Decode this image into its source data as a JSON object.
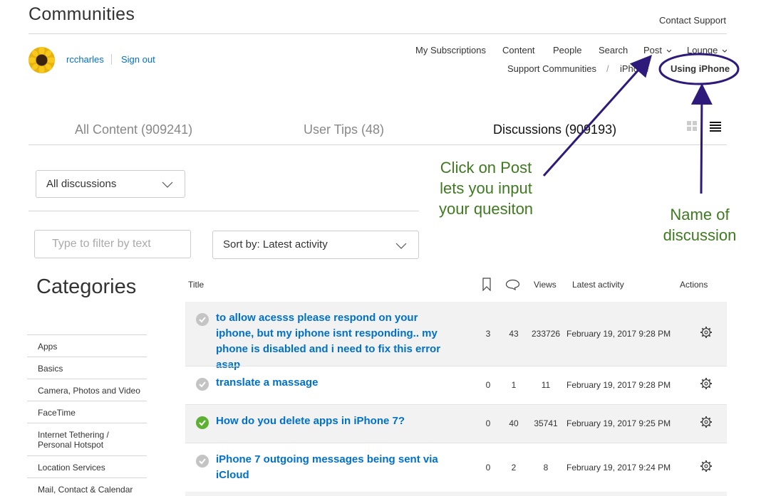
{
  "header": {
    "site_title": "Communities",
    "contact_support": "Contact Support",
    "username": "rccharles",
    "sign_out": "Sign out"
  },
  "nav": {
    "items": [
      {
        "label": "My Subscriptions"
      },
      {
        "label": "Content"
      },
      {
        "label": "People"
      },
      {
        "label": "Search"
      },
      {
        "label": "Post"
      },
      {
        "label": "Lounge"
      }
    ]
  },
  "breadcrumb": {
    "items": [
      "Support Communities",
      "iPhone"
    ],
    "separator": "/",
    "current": "Using iPhone"
  },
  "tabs": [
    {
      "label": "All Content (909241)"
    },
    {
      "label": "User Tips (48)"
    },
    {
      "label": "Discussions (909193)"
    }
  ],
  "filters": {
    "discussions_select": "All discussions",
    "filter_placeholder": "Type to filter by text",
    "sort_select": "Sort by: Latest activity"
  },
  "categories": {
    "title": "Categories",
    "items": [
      "Apps",
      "Basics",
      "Camera, Photos and Video",
      "FaceTime",
      "Internet Tethering / Personal Hotspot",
      "Location Services",
      "Mail, Contact & Calendar"
    ]
  },
  "table": {
    "headers": {
      "title": "Title",
      "views": "Views",
      "latest": "Latest activity",
      "actions": "Actions"
    },
    "rows": [
      {
        "title": "to allow acesss please respond on your iphone, but my iphone isnt responding.. my phone is disabled and i need to fix this error asap",
        "bookmarks": "3",
        "replies": "43",
        "views": "233726",
        "latest": "February 19, 2017 9:28 PM",
        "answered": false
      },
      {
        "title": "translate a massage",
        "bookmarks": "0",
        "replies": "1",
        "views": "11",
        "latest": "February 19, 2017 9:28 PM",
        "answered": false
      },
      {
        "title": "How do you delete apps in iPhone 7?",
        "bookmarks": "0",
        "replies": "40",
        "views": "35741",
        "latest": "February 19, 2017 9:25 PM",
        "answered": true
      },
      {
        "title": "iPhone 7 outgoing messages being sent via iCloud",
        "bookmarks": "0",
        "replies": "2",
        "views": "8",
        "latest": "February 19, 2017 9:24 PM",
        "answered": false
      }
    ]
  },
  "annotations": {
    "post_note": "Click on Post lets you input your quesiton",
    "discussion_note": "Name of discussion"
  },
  "colors": {
    "link": "#0070c9",
    "annotation_text": "#3f7a20",
    "annotation_arrow": "#2e1a7a",
    "answered": "#5cb032"
  }
}
